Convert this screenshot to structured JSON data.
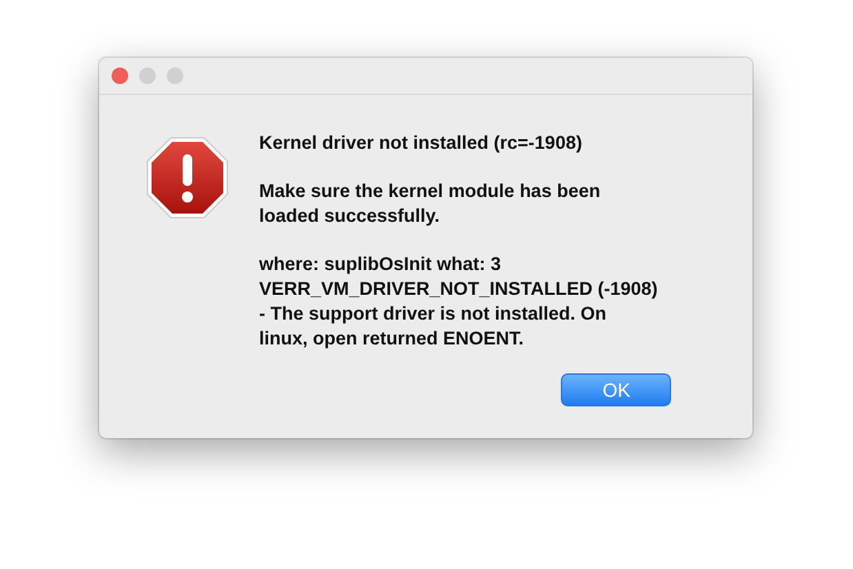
{
  "window": {
    "controls": [
      {
        "color": "#ee5f58"
      },
      {
        "color": "#d0d0d0"
      },
      {
        "color": "#d0d0d0"
      }
    ]
  },
  "dialog": {
    "kind": "error",
    "title": "Kernel driver not installed (rc=-1908)",
    "paragraphs": [
      [
        "Make sure the kernel module has been",
        "loaded successfully."
      ],
      [
        "where: suplibOsInit what: 3",
        "VERR_VM_DRIVER_NOT_INSTALLED (-1908)",
        "- The support driver is not installed. On",
        "linux, open returned ENOENT."
      ]
    ],
    "buttons": [
      {
        "label": "OK",
        "kind": "default"
      }
    ]
  }
}
